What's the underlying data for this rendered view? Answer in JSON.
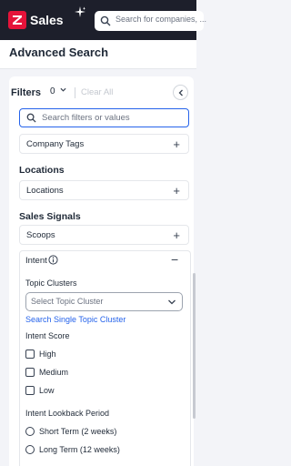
{
  "topbar": {
    "app_name": "Sales",
    "search_placeholder": "Search for companies, ..."
  },
  "page": {
    "title": "Advanced Search"
  },
  "filters": {
    "label": "Filters",
    "count": "0",
    "clear_all": "Clear All",
    "search_placeholder": "Search filters or values"
  },
  "rows": {
    "company_tags": "Company Tags",
    "locations": "Locations",
    "scoops": "Scoops"
  },
  "sections": {
    "locations": "Locations",
    "sales_signals": "Sales Signals"
  },
  "intent": {
    "label": "Intent",
    "topic_clusters_label": "Topic Clusters",
    "select_placeholder": "Select Topic Cluster",
    "single_cluster_link": "Search Single Topic Cluster",
    "score_label": "Intent Score",
    "scores": [
      "High",
      "Medium",
      "Low"
    ],
    "lookback_label": "Intent Lookback Period",
    "lookback_options": [
      "Short Term (2 weeks)",
      "Long Term (12 weeks)"
    ]
  },
  "colors": {
    "brand_red": "#e5133a",
    "topbar_bg": "#1d1f2b",
    "accent_blue": "#2563eb"
  }
}
